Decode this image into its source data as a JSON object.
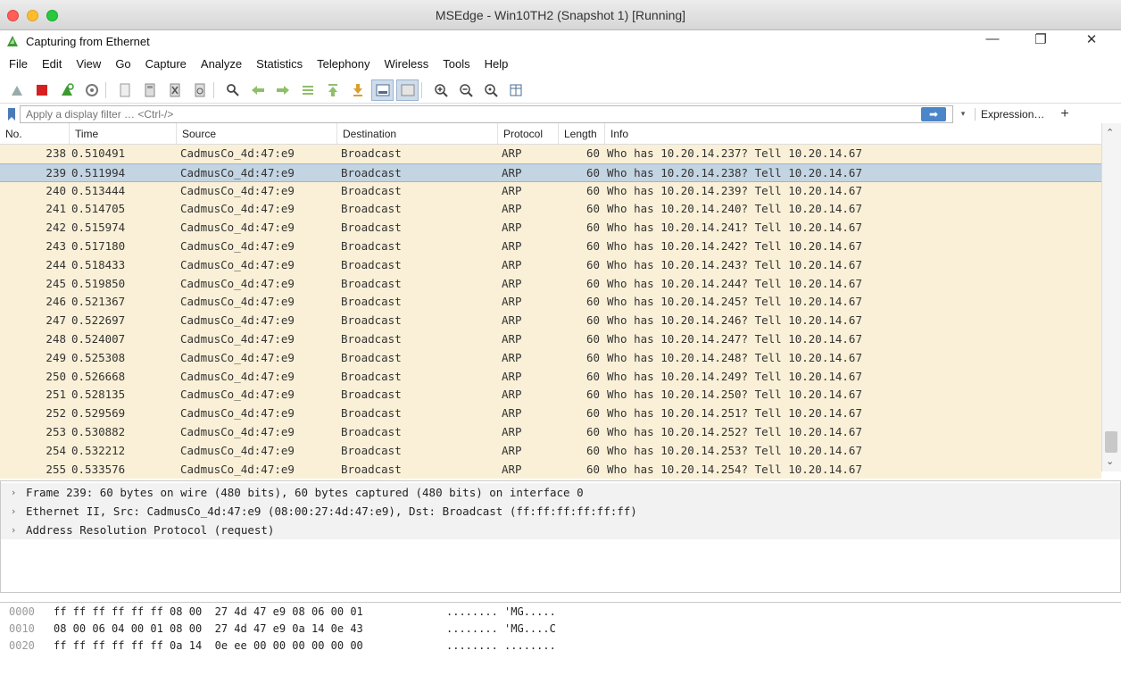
{
  "outer_window": {
    "title": "MSEdge - Win10TH2 (Snapshot 1) [Running]"
  },
  "app": {
    "title": "Capturing from Ethernet",
    "window_controls": {
      "minimize": "—",
      "restore": "❐",
      "close": "✕"
    }
  },
  "menu": [
    "File",
    "Edit",
    "View",
    "Go",
    "Capture",
    "Analyze",
    "Statistics",
    "Telephony",
    "Wireless",
    "Tools",
    "Help"
  ],
  "filter": {
    "placeholder": "Apply a display filter … <Ctrl-/>",
    "apply_glyph": "➡",
    "dropdown_glyph": "▾",
    "expression_label": "Expression…",
    "plus_label": "+"
  },
  "columns": [
    "No.",
    "Time",
    "Source",
    "Destination",
    "Protocol",
    "Length",
    "Info"
  ],
  "packets": [
    {
      "no": "238",
      "time": "0.510491",
      "src": "CadmusCo_4d:47:e9",
      "dst": "Broadcast",
      "proto": "ARP",
      "len": "60",
      "info": "Who has 10.20.14.237? Tell 10.20.14.67"
    },
    {
      "no": "239",
      "time": "0.511994",
      "src": "CadmusCo_4d:47:e9",
      "dst": "Broadcast",
      "proto": "ARP",
      "len": "60",
      "info": "Who has 10.20.14.238? Tell 10.20.14.67"
    },
    {
      "no": "240",
      "time": "0.513444",
      "src": "CadmusCo_4d:47:e9",
      "dst": "Broadcast",
      "proto": "ARP",
      "len": "60",
      "info": "Who has 10.20.14.239? Tell 10.20.14.67"
    },
    {
      "no": "241",
      "time": "0.514705",
      "src": "CadmusCo_4d:47:e9",
      "dst": "Broadcast",
      "proto": "ARP",
      "len": "60",
      "info": "Who has 10.20.14.240? Tell 10.20.14.67"
    },
    {
      "no": "242",
      "time": "0.515974",
      "src": "CadmusCo_4d:47:e9",
      "dst": "Broadcast",
      "proto": "ARP",
      "len": "60",
      "info": "Who has 10.20.14.241? Tell 10.20.14.67"
    },
    {
      "no": "243",
      "time": "0.517180",
      "src": "CadmusCo_4d:47:e9",
      "dst": "Broadcast",
      "proto": "ARP",
      "len": "60",
      "info": "Who has 10.20.14.242? Tell 10.20.14.67"
    },
    {
      "no": "244",
      "time": "0.518433",
      "src": "CadmusCo_4d:47:e9",
      "dst": "Broadcast",
      "proto": "ARP",
      "len": "60",
      "info": "Who has 10.20.14.243? Tell 10.20.14.67"
    },
    {
      "no": "245",
      "time": "0.519850",
      "src": "CadmusCo_4d:47:e9",
      "dst": "Broadcast",
      "proto": "ARP",
      "len": "60",
      "info": "Who has 10.20.14.244? Tell 10.20.14.67"
    },
    {
      "no": "246",
      "time": "0.521367",
      "src": "CadmusCo_4d:47:e9",
      "dst": "Broadcast",
      "proto": "ARP",
      "len": "60",
      "info": "Who has 10.20.14.245? Tell 10.20.14.67"
    },
    {
      "no": "247",
      "time": "0.522697",
      "src": "CadmusCo_4d:47:e9",
      "dst": "Broadcast",
      "proto": "ARP",
      "len": "60",
      "info": "Who has 10.20.14.246? Tell 10.20.14.67"
    },
    {
      "no": "248",
      "time": "0.524007",
      "src": "CadmusCo_4d:47:e9",
      "dst": "Broadcast",
      "proto": "ARP",
      "len": "60",
      "info": "Who has 10.20.14.247? Tell 10.20.14.67"
    },
    {
      "no": "249",
      "time": "0.525308",
      "src": "CadmusCo_4d:47:e9",
      "dst": "Broadcast",
      "proto": "ARP",
      "len": "60",
      "info": "Who has 10.20.14.248? Tell 10.20.14.67"
    },
    {
      "no": "250",
      "time": "0.526668",
      "src": "CadmusCo_4d:47:e9",
      "dst": "Broadcast",
      "proto": "ARP",
      "len": "60",
      "info": "Who has 10.20.14.249? Tell 10.20.14.67"
    },
    {
      "no": "251",
      "time": "0.528135",
      "src": "CadmusCo_4d:47:e9",
      "dst": "Broadcast",
      "proto": "ARP",
      "len": "60",
      "info": "Who has 10.20.14.250? Tell 10.20.14.67"
    },
    {
      "no": "252",
      "time": "0.529569",
      "src": "CadmusCo_4d:47:e9",
      "dst": "Broadcast",
      "proto": "ARP",
      "len": "60",
      "info": "Who has 10.20.14.251? Tell 10.20.14.67"
    },
    {
      "no": "253",
      "time": "0.530882",
      "src": "CadmusCo_4d:47:e9",
      "dst": "Broadcast",
      "proto": "ARP",
      "len": "60",
      "info": "Who has 10.20.14.252? Tell 10.20.14.67"
    },
    {
      "no": "254",
      "time": "0.532212",
      "src": "CadmusCo_4d:47:e9",
      "dst": "Broadcast",
      "proto": "ARP",
      "len": "60",
      "info": "Who has 10.20.14.253? Tell 10.20.14.67"
    },
    {
      "no": "255",
      "time": "0.533576",
      "src": "CadmusCo_4d:47:e9",
      "dst": "Broadcast",
      "proto": "ARP",
      "len": "60",
      "info": "Who has 10.20.14.254? Tell 10.20.14.67"
    }
  ],
  "selected_packet": "239",
  "details": [
    "Frame 239: 60 bytes on wire (480 bits), 60 bytes captured (480 bits) on interface 0",
    "Ethernet II, Src: CadmusCo_4d:47:e9 (08:00:27:4d:47:e9), Dst: Broadcast (ff:ff:ff:ff:ff:ff)",
    "Address Resolution Protocol (request)"
  ],
  "bytes": [
    {
      "offset": "0000",
      "hex": "ff ff ff ff ff ff 08 00  27 4d 47 e9 08 06 00 01",
      "ascii": "........ 'MG....."
    },
    {
      "offset": "0010",
      "hex": "08 00 06 04 00 01 08 00  27 4d 47 e9 0a 14 0e 43",
      "ascii": "........ 'MG....C"
    },
    {
      "offset": "0020",
      "hex": "ff ff ff ff ff ff 0a 14  0e ee 00 00 00 00 00 00",
      "ascii": "........ ........"
    }
  ],
  "colors": {
    "row_arp": "#faf0d7",
    "row_selected": "#c3d4e3",
    "mac_close": "#ff5f57",
    "mac_min": "#febc2e",
    "mac_max": "#28c840",
    "shark_fin": "#3a9a2e"
  }
}
